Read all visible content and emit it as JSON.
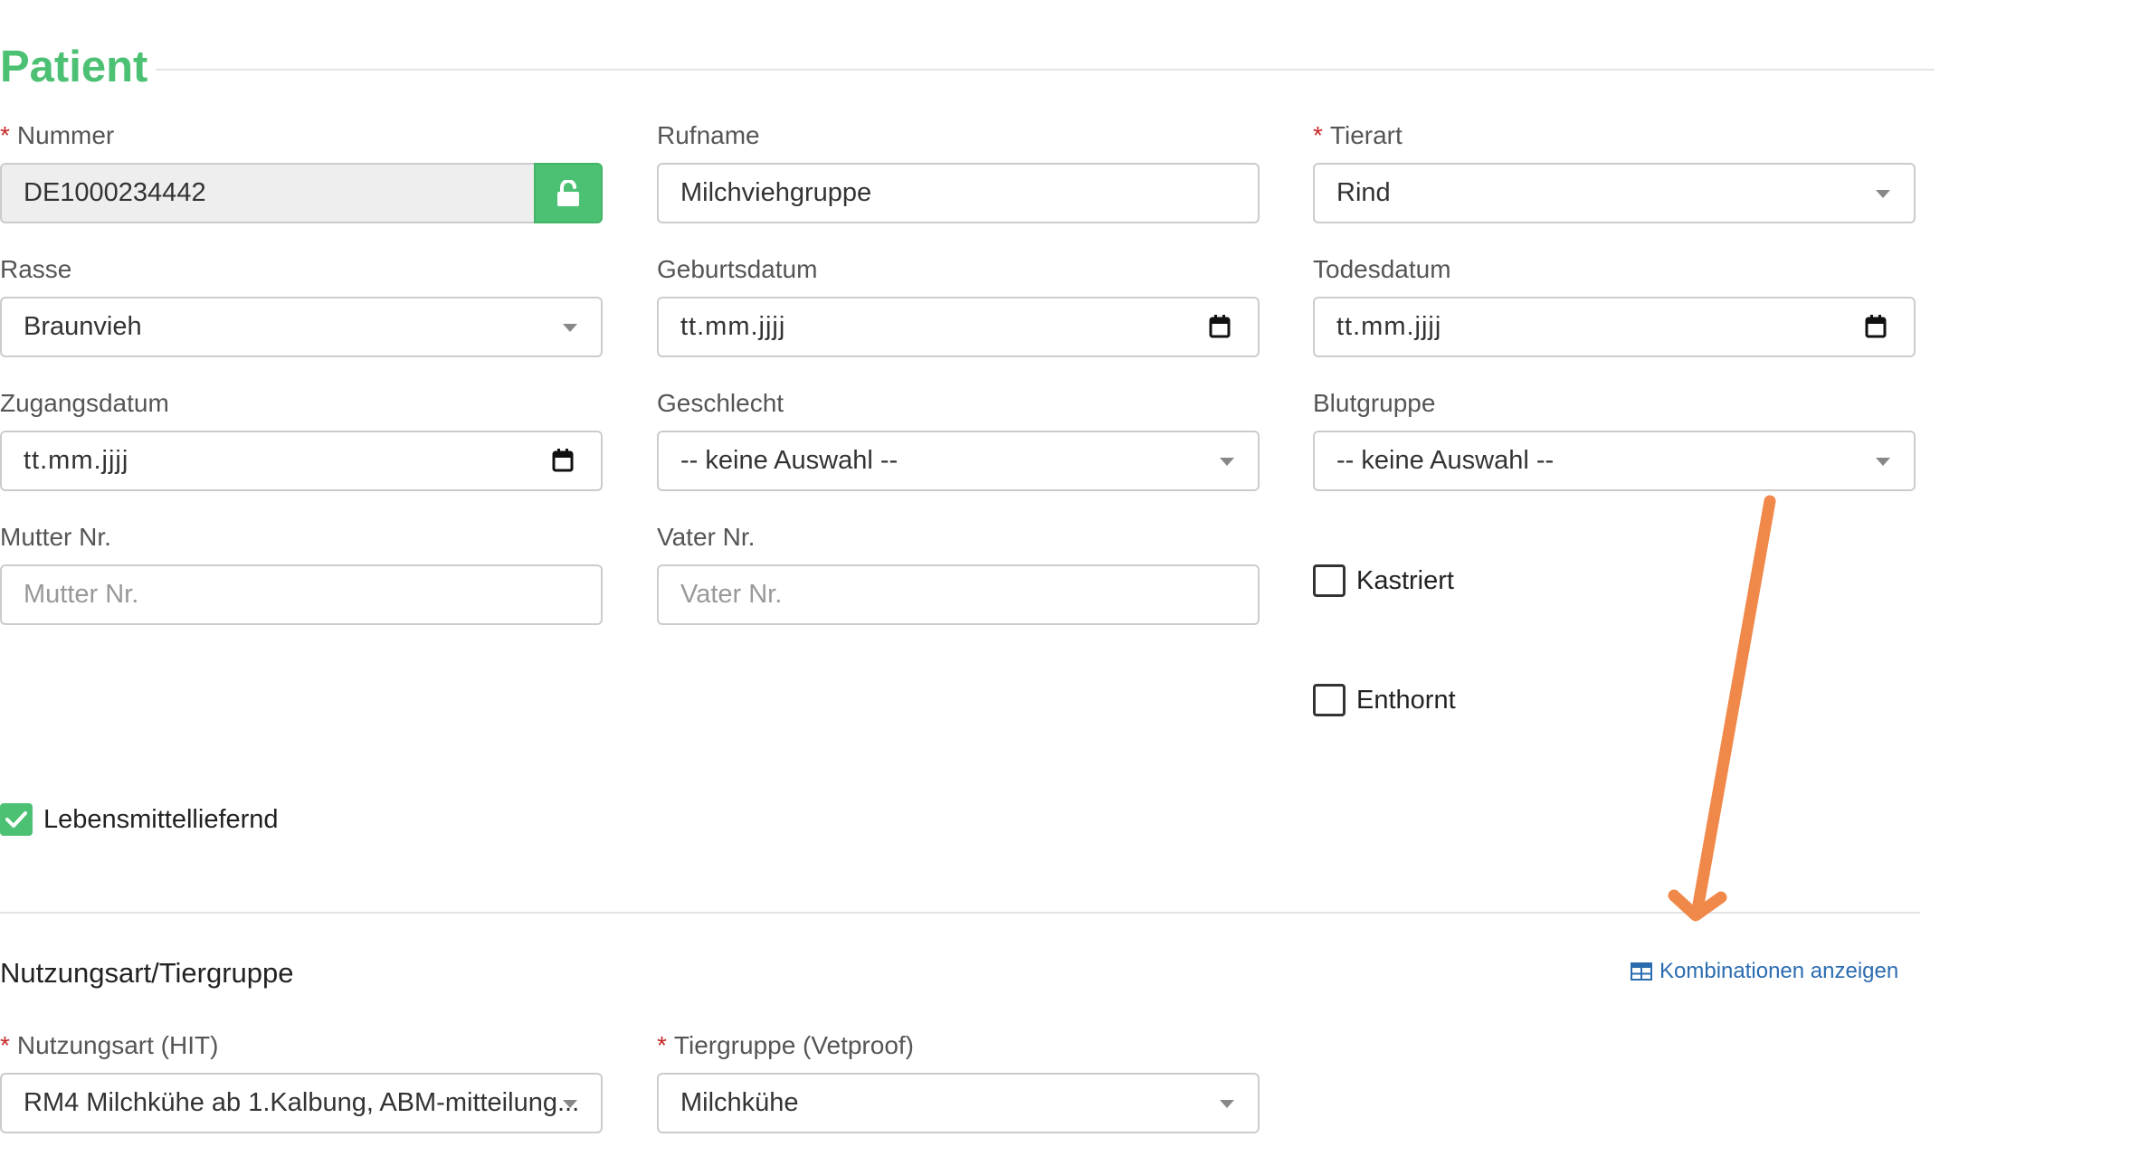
{
  "section": {
    "title": "Patient"
  },
  "fields": {
    "nummer": {
      "label": "Nummer",
      "required_mark": "*",
      "value": "DE1000234442"
    },
    "rufname": {
      "label": "Rufname",
      "value": "Milchviehgruppe"
    },
    "tierart": {
      "label": "Tierart",
      "required_mark": "*",
      "value": "Rind"
    },
    "rasse": {
      "label": "Rasse",
      "value": "Braunvieh"
    },
    "geburtsdatum": {
      "label": "Geburtsdatum",
      "value": "tt.mm.jjjj"
    },
    "todesdatum": {
      "label": "Todesdatum",
      "value": "tt.mm.jjjj"
    },
    "zugangsdatum": {
      "label": "Zugangsdatum",
      "value": "tt.mm.jjjj"
    },
    "geschlecht": {
      "label": "Geschlecht",
      "value": "-- keine Auswahl --"
    },
    "blutgruppe": {
      "label": "Blutgruppe",
      "value": "-- keine Auswahl --"
    },
    "mutter_nr": {
      "label": "Mutter Nr.",
      "placeholder": "Mutter Nr."
    },
    "vater_nr": {
      "label": "Vater Nr.",
      "placeholder": "Vater Nr."
    }
  },
  "checkboxes": {
    "kastriert": {
      "label": "Kastriert",
      "checked": false
    },
    "enthornt": {
      "label": "Enthornt",
      "checked": false
    },
    "lebensmittelliefernd": {
      "label": "Lebensmittelliefernd",
      "checked": true
    }
  },
  "usage_section": {
    "title": "Nutzungsart/Tiergruppe",
    "link_label": "Kombinationen anzeigen",
    "nutzungsart": {
      "label": "Nutzungsart (HIT)",
      "required_mark": "*",
      "value": "RM4 Milchkühe ab 1.Kalbung, ABM-mitteilung..."
    },
    "tiergruppe": {
      "label": "Tiergruppe (Vetproof)",
      "required_mark": "*",
      "value": "Milchkühe"
    }
  },
  "colors": {
    "accent_green": "#4cc174",
    "required_red": "#c62828",
    "link_blue": "#2b6cb0",
    "annotation_orange": "#f0884a"
  }
}
